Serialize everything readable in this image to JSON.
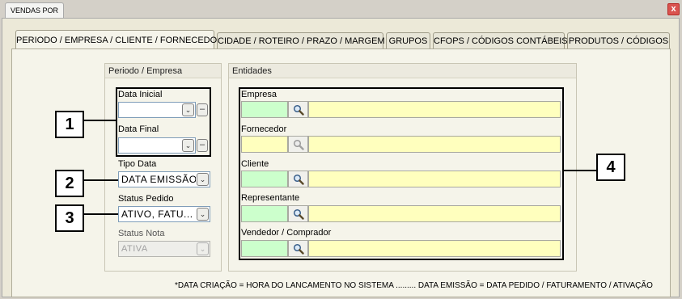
{
  "window": {
    "tab_title": "VENDAS POR",
    "close_label": "x"
  },
  "tabs": [
    {
      "label": "PERIODO / EMPRESA / CLIENTE / FORNECEDOR",
      "active": true
    },
    {
      "label": "CIDADE / ROTEIRO / PRAZO / MARGEM",
      "active": false
    },
    {
      "label": "GRUPOS",
      "active": false
    },
    {
      "label": "CFOPS / CÓDIGOS CONTÁBEIS",
      "active": false
    },
    {
      "label": "PRODUTOS / CÓDIGOS",
      "active": false
    }
  ],
  "periodo": {
    "header": "Periodo / Empresa",
    "data_inicial_label": "Data Inicial",
    "data_inicial_value": "",
    "data_final_label": "Data Final",
    "data_final_value": "",
    "tipo_data_label": "Tipo Data",
    "tipo_data_value": "DATA EMISSÃO",
    "status_pedido_label": "Status Pedido",
    "status_pedido_value": "ATIVO, FATU...",
    "status_nota_label": "Status Nota",
    "status_nota_value": "ATIVA"
  },
  "entidades": {
    "header": "Entidades",
    "empresa_label": "Empresa",
    "fornecedor_label": "Fornecedor",
    "cliente_label": "Cliente",
    "representante_label": "Representante",
    "vendedor_label": "Vendedor / Comprador"
  },
  "callouts": [
    "1",
    "2",
    "3",
    "4"
  ],
  "footnote": "*DATA CRIAÇÃO = HORA DO LANCAMENTO NO SISTEMA ......... DATA EMISSÃO = DATA PEDIDO / FATURAMENTO / ATIVAÇÃO",
  "icons": {
    "dropdown": "chevron-down-icon",
    "search": "magnifier-icon",
    "remove": "minus-icon"
  },
  "colors": {
    "green_field": "#ccffcc",
    "yellow_field": "#ffffbe",
    "close": "#d9534f"
  }
}
